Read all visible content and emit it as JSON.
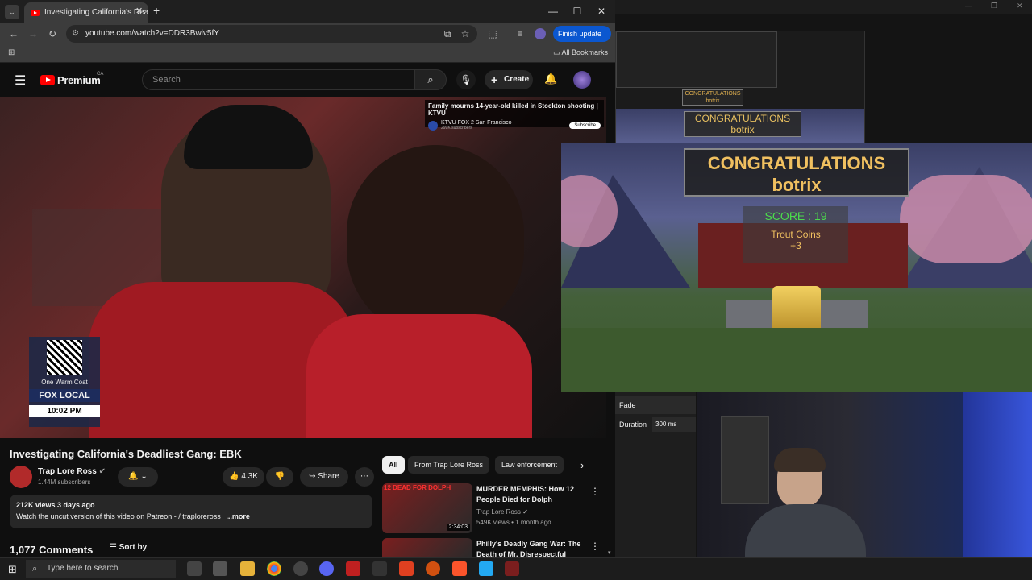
{
  "browser": {
    "tab_title": "Investigating California's Deadliest Gang: EBK",
    "url": "youtube.com/watch?v=DDR3Bwlv5fY",
    "finish_update": "Finish update",
    "all_bookmarks": "All Bookmarks"
  },
  "youtube": {
    "logo": "Premium",
    "region": "CA",
    "search_placeholder": "Search",
    "create": "Create",
    "video": {
      "overlay_title": "Family mourns 14-year-old killed in Stockton shooting | KTVU",
      "overlay_channel": "KTVU FOX 2 San Francisco",
      "overlay_subs": "299K subscribers",
      "overlay_subscribe": "Subscribe",
      "badge_line1": "One Warm Coat",
      "badge_line2": "FOX LOCAL",
      "badge_time": "10:02 PM"
    },
    "title": "Investigating California's Deadliest Gang: EBK",
    "channel_name": "Trap Lore Ross",
    "subscribers": "1.44M subscribers",
    "likes": "4.3K",
    "share": "Share",
    "views_line": "212K views  3 days ago",
    "desc_line": "Watch the uncut version of this video on Patreon -  / traploreross",
    "more": "...more",
    "comments": "1,077 Comments",
    "sort_by": "Sort by",
    "chips": [
      "All",
      "From Trap Lore Ross",
      "Law enforcement"
    ],
    "recommendations": [
      {
        "thumb_text": "12 DEAD FOR DOLPH",
        "duration": "2:34:03",
        "title": "MURDER MEMPHIS: How 12 People Died for Dolph",
        "channel": "Trap Lore Ross",
        "meta": "549K views • 1 month ago"
      },
      {
        "thumb_text": "",
        "duration": "",
        "title": "Philly's Deadly Gang War: The Death of Mr. Disrespectful",
        "channel": "",
        "meta": ""
      }
    ]
  },
  "game": {
    "congrats_line1": "CONGRATULATIONS",
    "congrats_line2": "botrix",
    "score": "SCORE : 19",
    "coins_line1": "Trout Coins",
    "coins_line2": "+3"
  },
  "obs": {
    "transition": "Fade",
    "duration_label": "Duration",
    "duration_value": "300 ms"
  },
  "taskbar": {
    "search_placeholder": "Type here to search"
  },
  "colors": {
    "youtube_red": "#ff0000",
    "chrome_blue": "#0b57d0",
    "score_green": "#4cdc4c",
    "gold": "#f0c060"
  }
}
